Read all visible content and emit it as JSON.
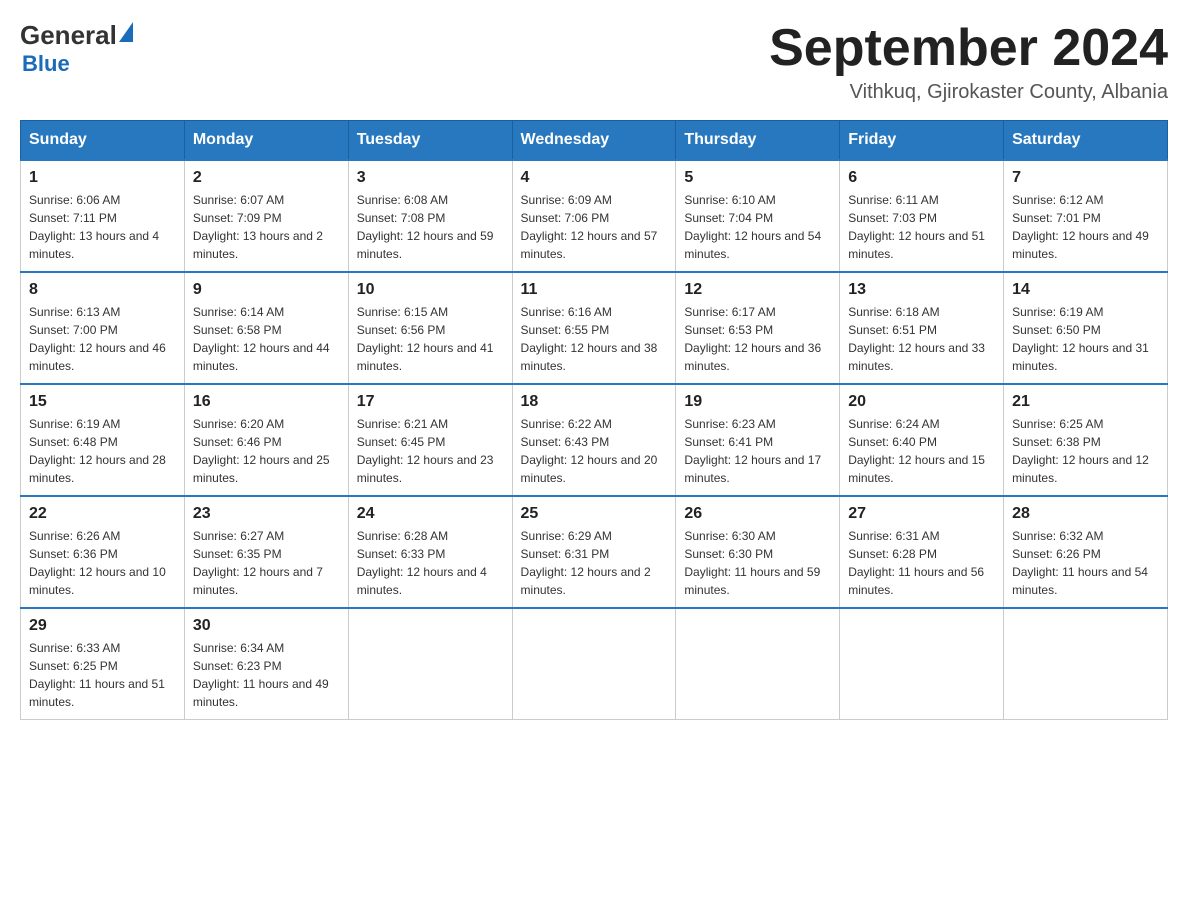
{
  "header": {
    "logo_general": "General",
    "logo_blue": "Blue",
    "month_title": "September 2024",
    "location": "Vithkuq, Gjirokaster County, Albania"
  },
  "days_of_week": [
    "Sunday",
    "Monday",
    "Tuesday",
    "Wednesday",
    "Thursday",
    "Friday",
    "Saturday"
  ],
  "weeks": [
    [
      {
        "day": "1",
        "sunrise": "6:06 AM",
        "sunset": "7:11 PM",
        "daylight": "13 hours and 4 minutes."
      },
      {
        "day": "2",
        "sunrise": "6:07 AM",
        "sunset": "7:09 PM",
        "daylight": "13 hours and 2 minutes."
      },
      {
        "day": "3",
        "sunrise": "6:08 AM",
        "sunset": "7:08 PM",
        "daylight": "12 hours and 59 minutes."
      },
      {
        "day": "4",
        "sunrise": "6:09 AM",
        "sunset": "7:06 PM",
        "daylight": "12 hours and 57 minutes."
      },
      {
        "day": "5",
        "sunrise": "6:10 AM",
        "sunset": "7:04 PM",
        "daylight": "12 hours and 54 minutes."
      },
      {
        "day": "6",
        "sunrise": "6:11 AM",
        "sunset": "7:03 PM",
        "daylight": "12 hours and 51 minutes."
      },
      {
        "day": "7",
        "sunrise": "6:12 AM",
        "sunset": "7:01 PM",
        "daylight": "12 hours and 49 minutes."
      }
    ],
    [
      {
        "day": "8",
        "sunrise": "6:13 AM",
        "sunset": "7:00 PM",
        "daylight": "12 hours and 46 minutes."
      },
      {
        "day": "9",
        "sunrise": "6:14 AM",
        "sunset": "6:58 PM",
        "daylight": "12 hours and 44 minutes."
      },
      {
        "day": "10",
        "sunrise": "6:15 AM",
        "sunset": "6:56 PM",
        "daylight": "12 hours and 41 minutes."
      },
      {
        "day": "11",
        "sunrise": "6:16 AM",
        "sunset": "6:55 PM",
        "daylight": "12 hours and 38 minutes."
      },
      {
        "day": "12",
        "sunrise": "6:17 AM",
        "sunset": "6:53 PM",
        "daylight": "12 hours and 36 minutes."
      },
      {
        "day": "13",
        "sunrise": "6:18 AM",
        "sunset": "6:51 PM",
        "daylight": "12 hours and 33 minutes."
      },
      {
        "day": "14",
        "sunrise": "6:19 AM",
        "sunset": "6:50 PM",
        "daylight": "12 hours and 31 minutes."
      }
    ],
    [
      {
        "day": "15",
        "sunrise": "6:19 AM",
        "sunset": "6:48 PM",
        "daylight": "12 hours and 28 minutes."
      },
      {
        "day": "16",
        "sunrise": "6:20 AM",
        "sunset": "6:46 PM",
        "daylight": "12 hours and 25 minutes."
      },
      {
        "day": "17",
        "sunrise": "6:21 AM",
        "sunset": "6:45 PM",
        "daylight": "12 hours and 23 minutes."
      },
      {
        "day": "18",
        "sunrise": "6:22 AM",
        "sunset": "6:43 PM",
        "daylight": "12 hours and 20 minutes."
      },
      {
        "day": "19",
        "sunrise": "6:23 AM",
        "sunset": "6:41 PM",
        "daylight": "12 hours and 17 minutes."
      },
      {
        "day": "20",
        "sunrise": "6:24 AM",
        "sunset": "6:40 PM",
        "daylight": "12 hours and 15 minutes."
      },
      {
        "day": "21",
        "sunrise": "6:25 AM",
        "sunset": "6:38 PM",
        "daylight": "12 hours and 12 minutes."
      }
    ],
    [
      {
        "day": "22",
        "sunrise": "6:26 AM",
        "sunset": "6:36 PM",
        "daylight": "12 hours and 10 minutes."
      },
      {
        "day": "23",
        "sunrise": "6:27 AM",
        "sunset": "6:35 PM",
        "daylight": "12 hours and 7 minutes."
      },
      {
        "day": "24",
        "sunrise": "6:28 AM",
        "sunset": "6:33 PM",
        "daylight": "12 hours and 4 minutes."
      },
      {
        "day": "25",
        "sunrise": "6:29 AM",
        "sunset": "6:31 PM",
        "daylight": "12 hours and 2 minutes."
      },
      {
        "day": "26",
        "sunrise": "6:30 AM",
        "sunset": "6:30 PM",
        "daylight": "11 hours and 59 minutes."
      },
      {
        "day": "27",
        "sunrise": "6:31 AM",
        "sunset": "6:28 PM",
        "daylight": "11 hours and 56 minutes."
      },
      {
        "day": "28",
        "sunrise": "6:32 AM",
        "sunset": "6:26 PM",
        "daylight": "11 hours and 54 minutes."
      }
    ],
    [
      {
        "day": "29",
        "sunrise": "6:33 AM",
        "sunset": "6:25 PM",
        "daylight": "11 hours and 51 minutes."
      },
      {
        "day": "30",
        "sunrise": "6:34 AM",
        "sunset": "6:23 PM",
        "daylight": "11 hours and 49 minutes."
      },
      null,
      null,
      null,
      null,
      null
    ]
  ],
  "labels": {
    "sunrise": "Sunrise:",
    "sunset": "Sunset:",
    "daylight": "Daylight:"
  }
}
